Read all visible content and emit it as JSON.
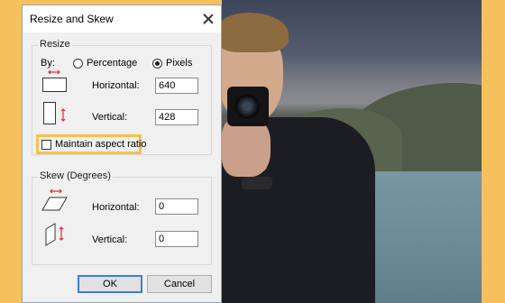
{
  "dialog": {
    "title": "Resize and Skew",
    "resize": {
      "group_label": "Resize",
      "by_label": "By:",
      "option_percentage": "Percentage",
      "option_pixels": "Pixels",
      "selected": "Pixels",
      "horizontal_label": "Horizontal:",
      "horizontal_value": "640",
      "vertical_label": "Vertical:",
      "vertical_value": "428",
      "maintain_label": "Maintain aspect ratio",
      "maintain_checked": false
    },
    "skew": {
      "group_label": "Skew (Degrees)",
      "horizontal_label": "Horizontal:",
      "horizontal_value": "0",
      "vertical_label": "Vertical:",
      "vertical_value": "0"
    },
    "ok_label": "OK",
    "cancel_label": "Cancel"
  },
  "colors": {
    "background": "#f6c15d",
    "highlight": "#f5c24a",
    "arrow": "#e0282f",
    "default_button_border": "#3c7fd1"
  },
  "icons": [
    "close-icon",
    "resize-horizontal-icon",
    "resize-vertical-icon",
    "skew-horizontal-icon",
    "skew-vertical-icon"
  ]
}
